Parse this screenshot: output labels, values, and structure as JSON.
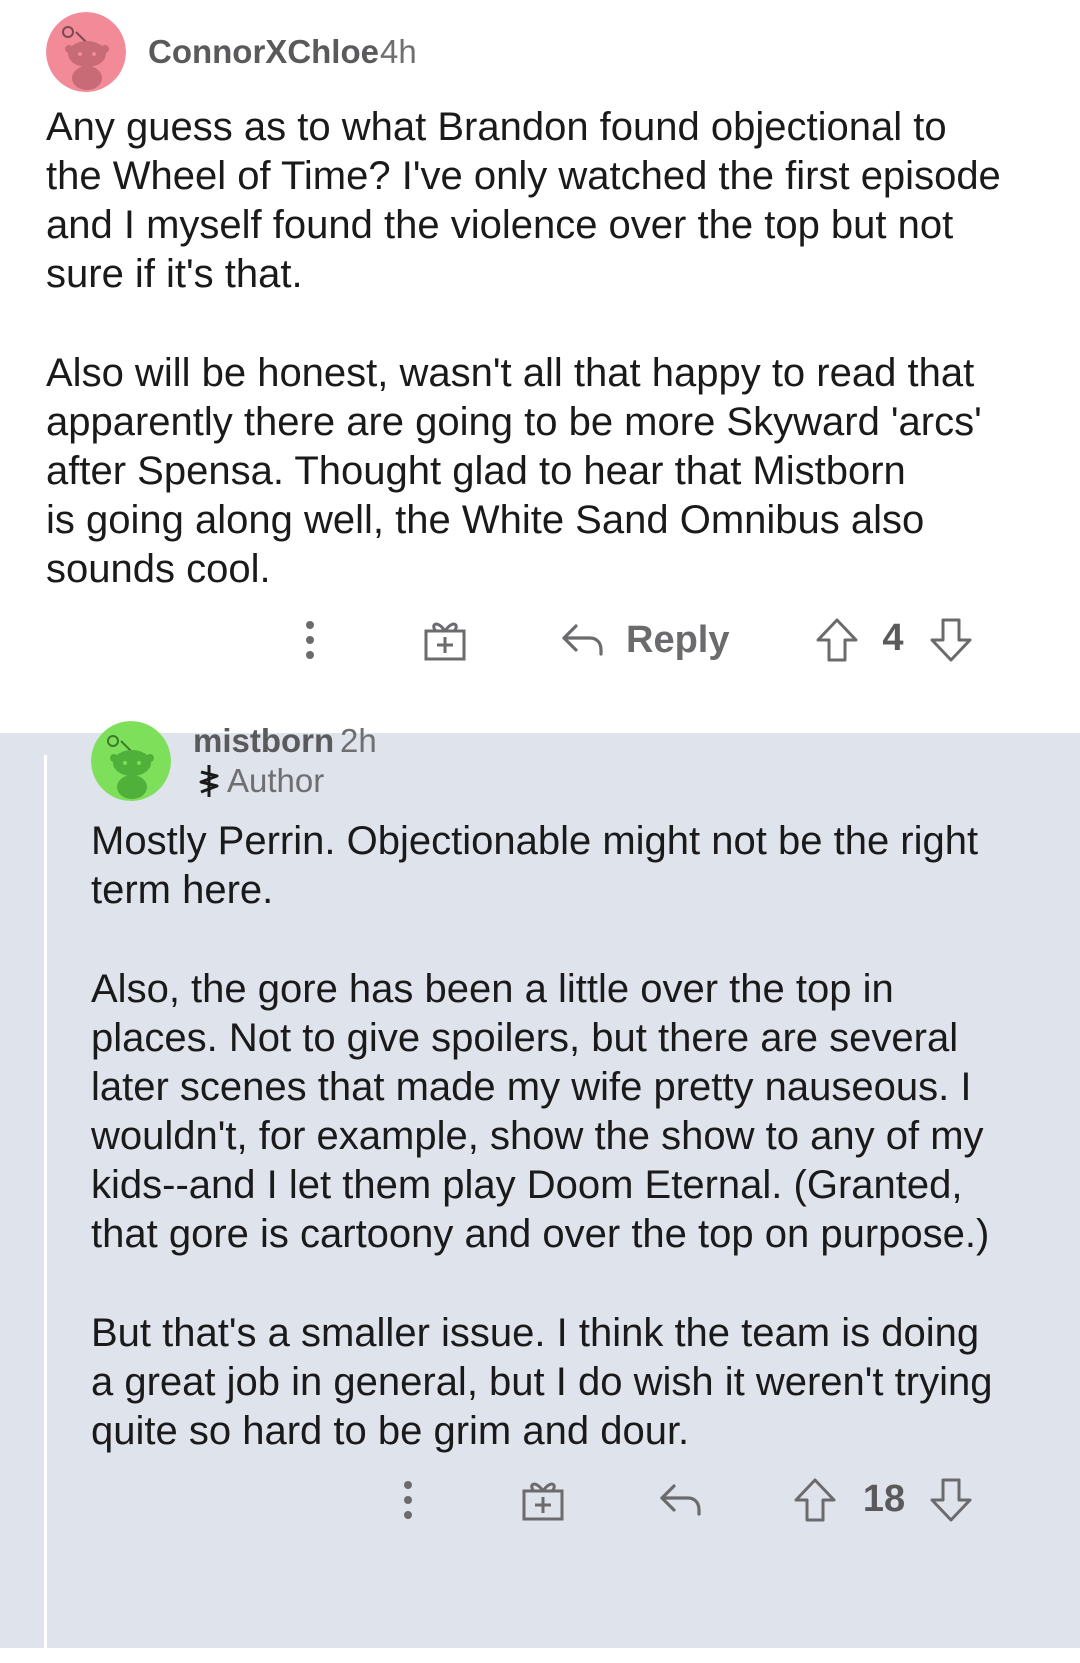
{
  "top_comment": {
    "username": "ConnorXChloe",
    "time": "4h",
    "avatar_color": "#f28b97",
    "paragraphs": [
      "Any guess as to what Brandon found objectional to\nthe Wheel of Time? I've only watched the first episode\nand I myself found the violence over the top but not\nsure if it's that.",
      "Also will be honest, wasn't all that happy to read that\napparently there are going to be more Skyward 'arcs'\nafter Spensa. Thought glad to hear that Mistborn\nis going along well, the White Sand Omnibus also\nsounds cool."
    ],
    "actions": {
      "more_icon": "vertical-dots-icon",
      "award_icon": "gift-icon",
      "reply_icon": "reply-arrow-icon",
      "reply_label": "Reply",
      "upvote_icon": "upvote-arrow-icon",
      "downvote_icon": "downvote-arrow-icon",
      "score": "4"
    }
  },
  "reply_comment": {
    "username": "mistborn",
    "time": "2h",
    "avatar_color": "#7ee05a",
    "flair_icon": "allomancy-symbol-icon",
    "flair": "Author",
    "background_color": "#dfe3ec",
    "paragraphs": [
      "Mostly Perrin.  Objectionable might not be the right\nterm here.",
      "Also, the gore has been a little over the top in\nplaces.  Not to give spoilers, but there are several\nlater scenes that made my wife pretty nauseous.  I\nwouldn't, for example, show the show to any of my\nkids--and I let them play Doom Eternal.  (Granted,\nthat gore is cartoony and over the top on purpose.)",
      "But that's a smaller issue.  I think the team is doing\na great job in general, but I do wish it weren't trying\nquite so hard to be grim and dour."
    ],
    "actions": {
      "more_icon": "vertical-dots-icon",
      "award_icon": "gift-icon",
      "reply_icon": "reply-arrow-icon",
      "upvote_icon": "upvote-arrow-icon",
      "downvote_icon": "downvote-arrow-icon",
      "score": "18"
    }
  }
}
